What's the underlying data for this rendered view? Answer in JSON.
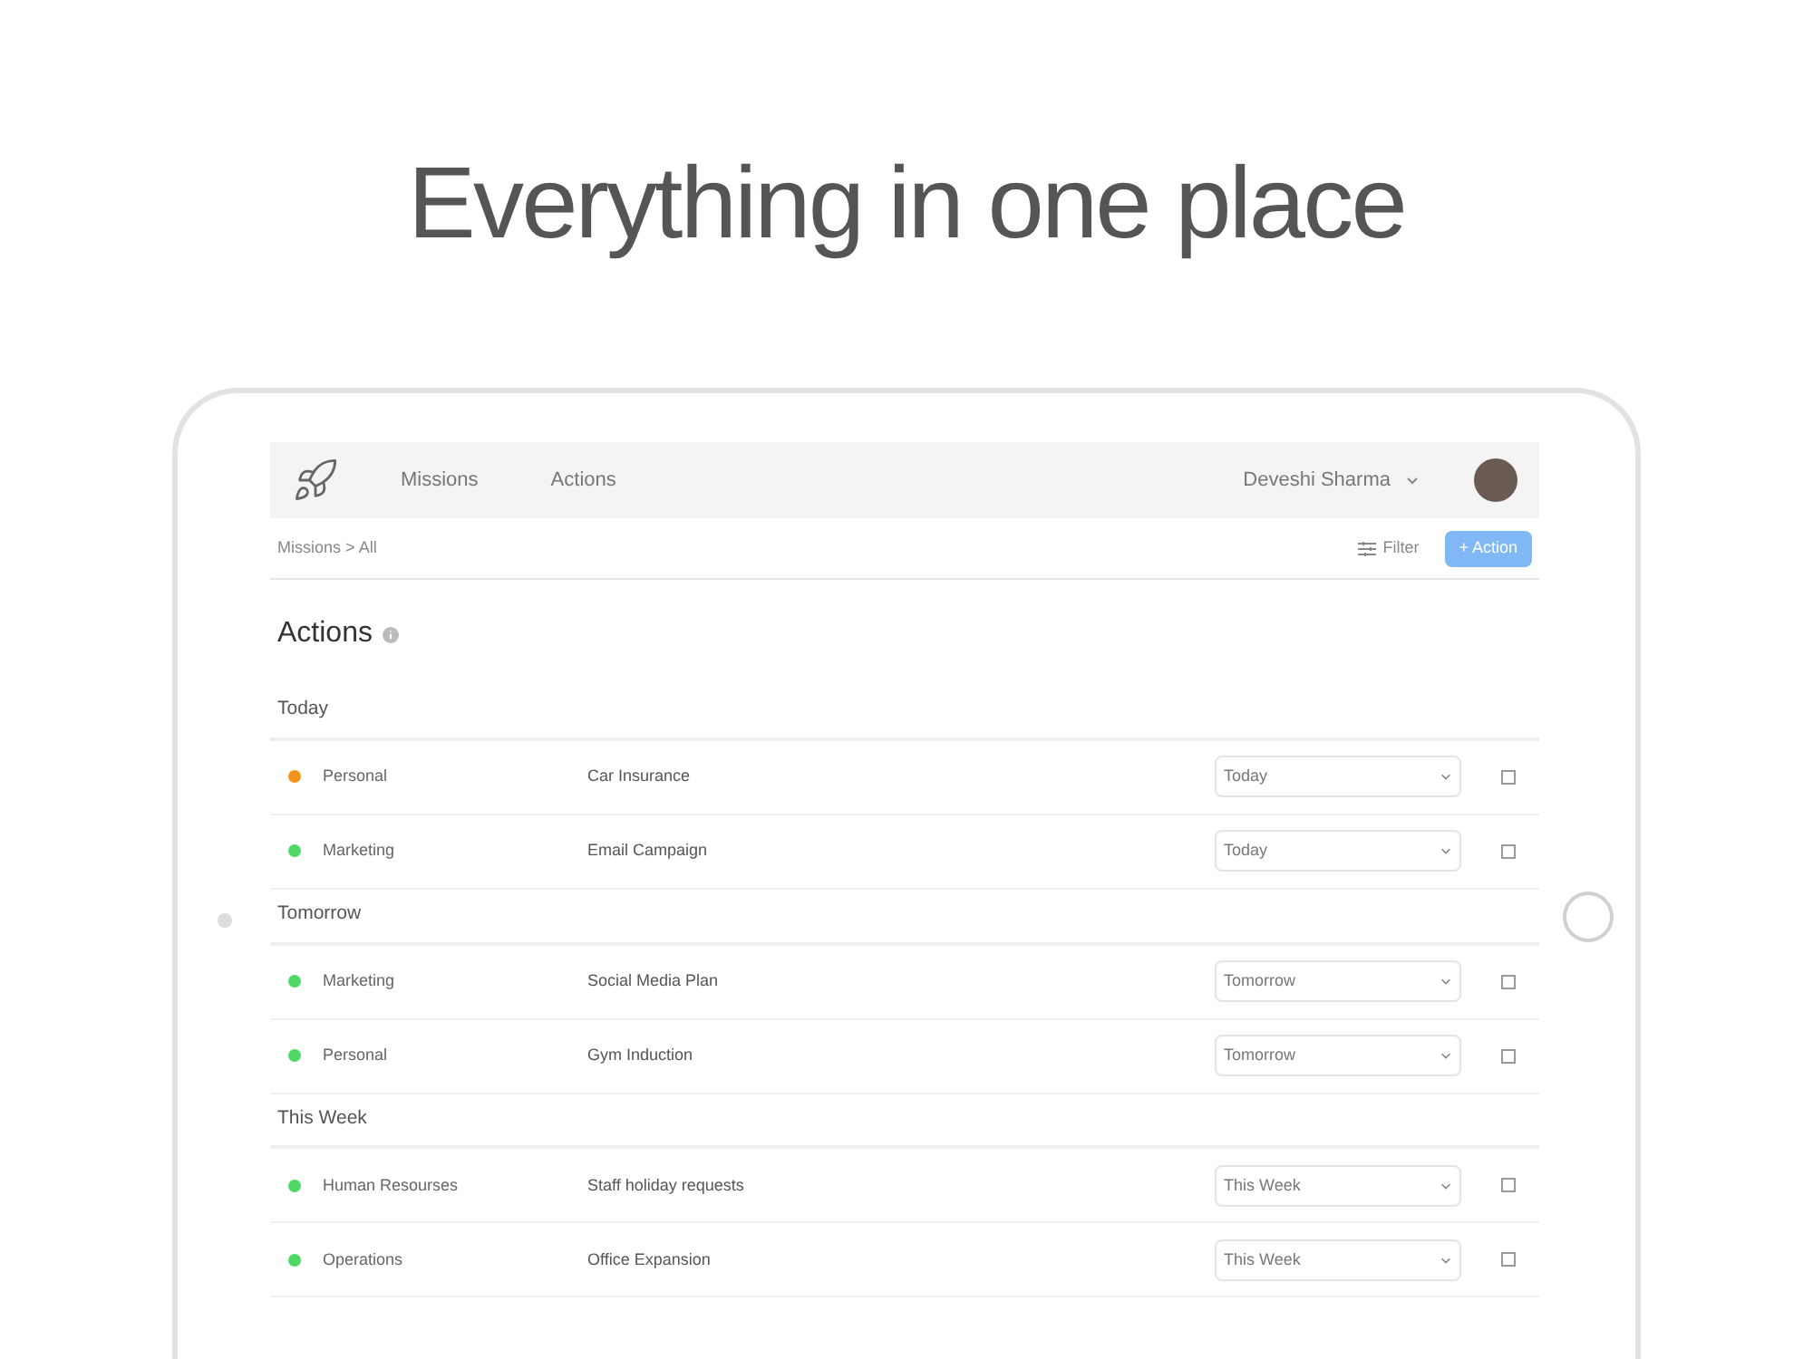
{
  "headline": "Everything in one place",
  "nav": {
    "links": [
      "Missions",
      "Actions"
    ],
    "user": "Deveshi Sharma"
  },
  "breadcrumb": {
    "parent": "Missions",
    "separator": ">",
    "current": "All"
  },
  "toolbar": {
    "filter": "Filter",
    "add_button": "+ Action"
  },
  "page_title": "Actions",
  "groups": [
    {
      "title": "Today",
      "rows": [
        {
          "category": "Personal",
          "color": "#f39219",
          "task": "Car Insurance",
          "due": "Today",
          "checked": false
        },
        {
          "category": "Marketing",
          "color": "#4cd964",
          "task": "Email Campaign",
          "due": "Today",
          "checked": false
        }
      ]
    },
    {
      "title": "Tomorrow",
      "rows": [
        {
          "category": "Marketing",
          "color": "#4cd964",
          "task": "Social Media Plan",
          "due": "Tomorrow",
          "checked": false
        },
        {
          "category": "Personal",
          "color": "#4cd964",
          "task": "Gym Induction",
          "due": "Tomorrow",
          "checked": false
        }
      ]
    },
    {
      "title": "This Week",
      "rows": [
        {
          "category": "Human Resourses",
          "color": "#4cd964",
          "task": "Staff holiday requests",
          "due": "This Week",
          "checked": false
        },
        {
          "category": "Operations",
          "color": "#4cd964",
          "task": "Office Expansion",
          "due": "This Week",
          "checked": false
        }
      ]
    }
  ]
}
